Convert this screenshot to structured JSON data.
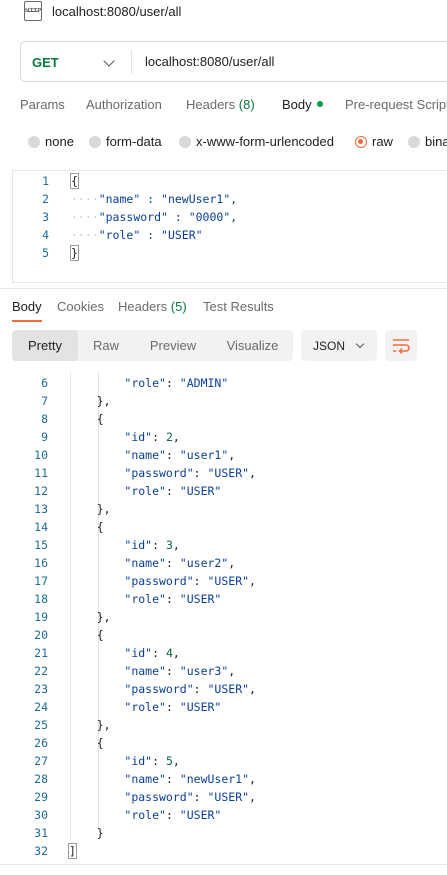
{
  "tab": {
    "title": "localhost:8080/user/all",
    "icon": "http-file-icon",
    "icon_text": "HTTP"
  },
  "request": {
    "method": "GET",
    "url": "localhost:8080/user/all",
    "method_color": "#0b7a3e"
  },
  "request_tabs": [
    {
      "label": "Params"
    },
    {
      "label": "Authorization"
    },
    {
      "label": "Headers",
      "count": "(8)"
    },
    {
      "label": "Body",
      "active": true
    },
    {
      "label": "Pre-request Script"
    }
  ],
  "body_types": [
    {
      "label": "none",
      "selected": false
    },
    {
      "label": "form-data",
      "selected": false
    },
    {
      "label": "x-www-form-urlencoded",
      "selected": false
    },
    {
      "label": "raw",
      "selected": true
    },
    {
      "label": "binary",
      "selected": false
    }
  ],
  "request_body": {
    "line_numbers": [
      "1",
      "2",
      "3",
      "4",
      "5"
    ],
    "lines": [
      "{",
      "\"name\" : \"newUser1\",",
      "\"password\" : \"0000\",",
      "\"role\" : \"USER\"",
      "}"
    ]
  },
  "response_tabs": [
    {
      "label": "Body",
      "active": true
    },
    {
      "label": "Cookies"
    },
    {
      "label": "Headers",
      "count": "(5)"
    },
    {
      "label": "Test Results"
    }
  ],
  "view_modes": [
    "Pretty",
    "Raw",
    "Preview",
    "Visualize"
  ],
  "active_view": "Pretty",
  "format": "JSON",
  "response_body": {
    "line_numbers": [
      "6",
      "7",
      "8",
      "9",
      "10",
      "11",
      "12",
      "13",
      "14",
      "15",
      "16",
      "17",
      "18",
      "19",
      "20",
      "21",
      "22",
      "23",
      "24",
      "25",
      "26",
      "27",
      "28",
      "29",
      "30",
      "31",
      "32"
    ],
    "lines": [
      "        \"role\": \"ADMIN\"",
      "    },",
      "    {",
      "        \"id\": 2,",
      "        \"name\": \"user1\",",
      "        \"password\": \"USER\",",
      "        \"role\": \"USER\"",
      "    },",
      "    {",
      "        \"id\": 3,",
      "        \"name\": \"user2\",",
      "        \"password\": \"USER\",",
      "        \"role\": \"USER\"",
      "    },",
      "    {",
      "        \"id\": 4,",
      "        \"name\": \"user3\",",
      "        \"password\": \"USER\",",
      "        \"role\": \"USER\"",
      "    },",
      "    {",
      "        \"id\": 5,",
      "        \"name\": \"newUser1\",",
      "        \"password\": \"USER\",",
      "        \"role\": \"USER\"",
      "    }",
      "]"
    ]
  },
  "colors": {
    "accent": "#f26b3a",
    "key": "#0b3f9b",
    "line_number": "#1e6b9a",
    "count": "#0b7a3e"
  }
}
